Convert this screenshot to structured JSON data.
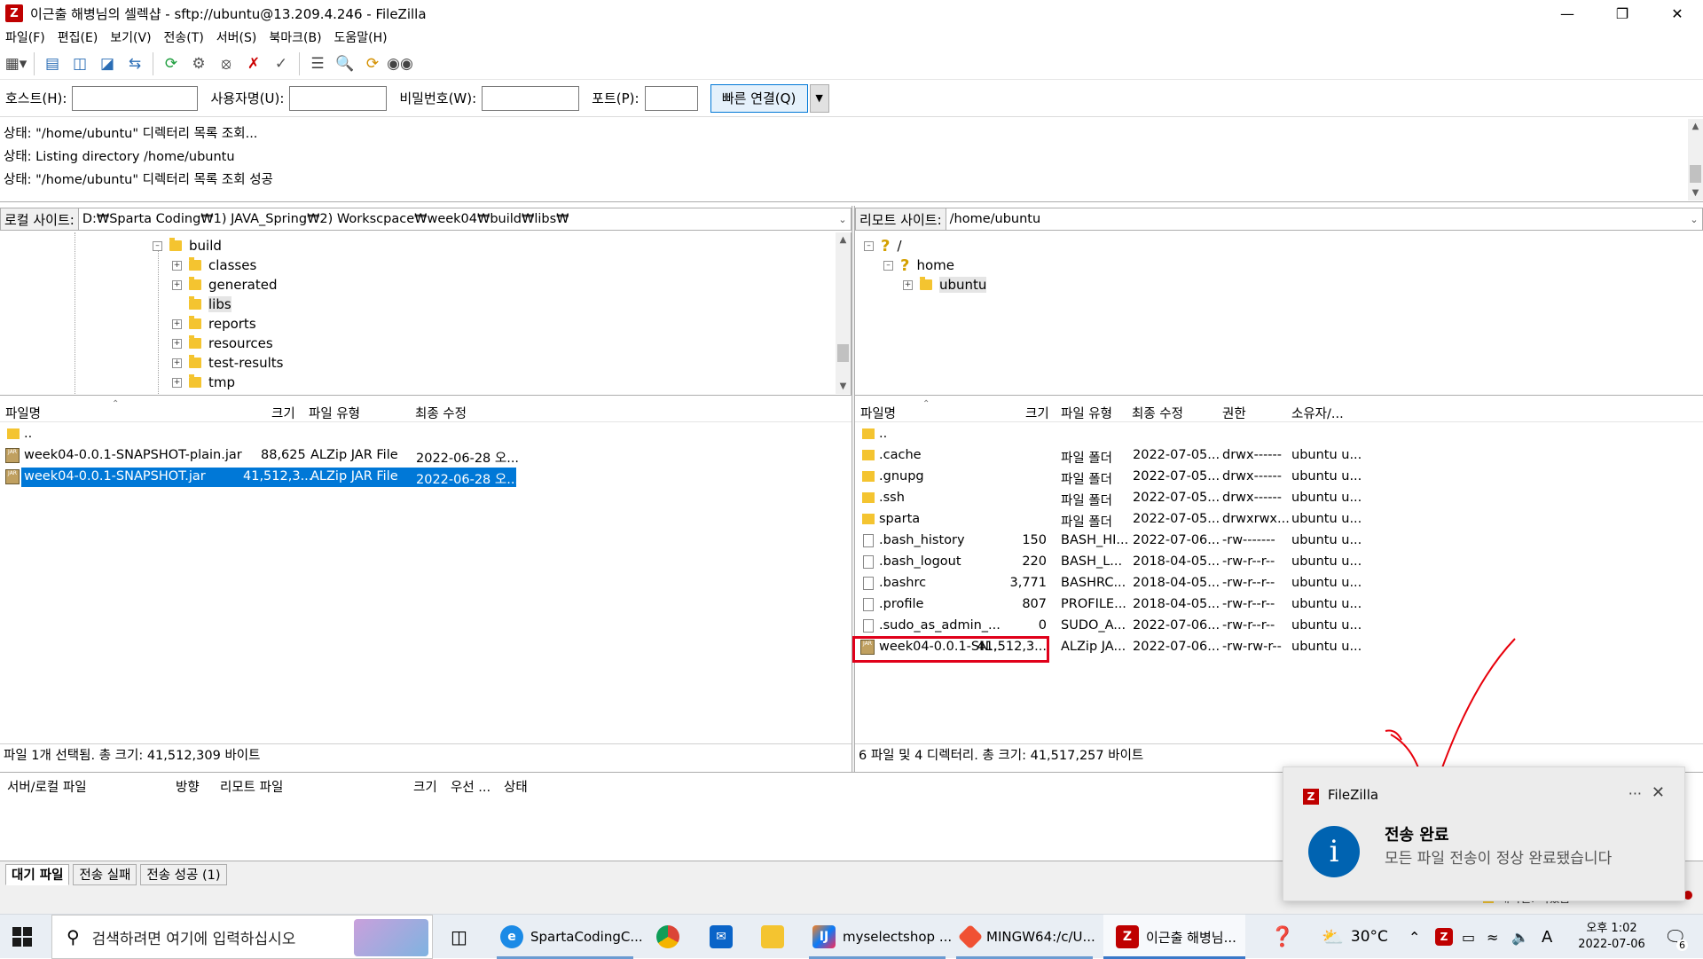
{
  "window": {
    "title": "이근출 해병님의 셀렉샵 - sftp://ubuntu@13.209.4.246 - FileZilla",
    "app_icon": "filezilla-icon"
  },
  "menu": [
    "파일(F)",
    "편집(E)",
    "보기(V)",
    "전송(T)",
    "서버(S)",
    "북마크(B)",
    "도움말(H)"
  ],
  "quickconnect": {
    "host_label": "호스트(H):",
    "host_value": "",
    "user_label": "사용자명(U):",
    "user_value": "",
    "pass_label": "비밀번호(W):",
    "pass_value": "",
    "port_label": "포트(P):",
    "port_value": "",
    "connect_button": "빠른 연결(Q)"
  },
  "log": [
    "상태: \"/home/ubuntu\" 디렉터리 목록 조회...",
    "상태: Listing directory /home/ubuntu",
    "상태: \"/home/ubuntu\" 디렉터리 목록 조회 성공"
  ],
  "local": {
    "site_label": "로컬 사이트:",
    "path": "D:₩Sparta Coding₩1) JAVA_Spring₩2) Workscpace₩week04₩build₩libs₩",
    "tree": [
      {
        "name": "build",
        "expander": "minus",
        "level": 0
      },
      {
        "name": "classes",
        "expander": "plus",
        "level": 1
      },
      {
        "name": "generated",
        "expander": "plus",
        "level": 1
      },
      {
        "name": "libs",
        "expander": "none",
        "level": 1
      },
      {
        "name": "reports",
        "expander": "plus",
        "level": 1
      },
      {
        "name": "resources",
        "expander": "plus",
        "level": 1
      },
      {
        "name": "test-results",
        "expander": "plus",
        "level": 1
      },
      {
        "name": "tmp",
        "expander": "plus",
        "level": 1
      }
    ],
    "columns": [
      "파일명",
      "크기",
      "파일 유형",
      "최종 수정"
    ],
    "files": [
      {
        "name": "..",
        "size": "",
        "type": "",
        "modified": "",
        "icon": "folder-icon",
        "selected": false
      },
      {
        "name": "week04-0.0.1-SNAPSHOT-plain.jar",
        "size": "88,625",
        "type": "ALZip JAR File",
        "modified": "2022-06-28 오...",
        "icon": "jar-icon",
        "selected": false
      },
      {
        "name": "week04-0.0.1-SNAPSHOT.jar",
        "size": "41,512,3...",
        "type": "ALZip JAR File",
        "modified": "2022-06-28 오...",
        "icon": "jar-icon",
        "selected": true
      }
    ],
    "status": "파일 1개 선택됨. 총 크기: 41,512,309 바이트"
  },
  "remote": {
    "site_label": "리모트 사이트:",
    "path": "/home/ubuntu",
    "tree": [
      {
        "name": "/",
        "icon": "question-icon",
        "expander": "minus",
        "level": 0
      },
      {
        "name": "home",
        "icon": "question-icon",
        "expander": "minus",
        "level": 1
      },
      {
        "name": "ubuntu",
        "icon": "folder-icon",
        "expander": "plus",
        "level": 2
      }
    ],
    "columns": [
      "파일명",
      "크기",
      "파일 유형",
      "최종 수정",
      "권한",
      "소유자/..."
    ],
    "files": [
      {
        "name": "..",
        "size": "",
        "type": "",
        "modified": "",
        "perm": "",
        "owner": "",
        "icon": "folder-icon"
      },
      {
        "name": ".cache",
        "size": "",
        "type": "파일 폴더",
        "modified": "2022-07-05...",
        "perm": "drwx------",
        "owner": "ubuntu u...",
        "icon": "folder-icon"
      },
      {
        "name": ".gnupg",
        "size": "",
        "type": "파일 폴더",
        "modified": "2022-07-05...",
        "perm": "drwx------",
        "owner": "ubuntu u...",
        "icon": "folder-icon"
      },
      {
        "name": ".ssh",
        "size": "",
        "type": "파일 폴더",
        "modified": "2022-07-05...",
        "perm": "drwx------",
        "owner": "ubuntu u...",
        "icon": "folder-icon"
      },
      {
        "name": "sparta",
        "size": "",
        "type": "파일 폴더",
        "modified": "2022-07-05...",
        "perm": "drwxrwx...",
        "owner": "ubuntu u...",
        "icon": "folder-icon"
      },
      {
        "name": ".bash_history",
        "size": "150",
        "type": "BASH_HI...",
        "modified": "2022-07-06...",
        "perm": "-rw-------",
        "owner": "ubuntu u...",
        "icon": "file-icon"
      },
      {
        "name": ".bash_logout",
        "size": "220",
        "type": "BASH_L...",
        "modified": "2018-04-05...",
        "perm": "-rw-r--r--",
        "owner": "ubuntu u...",
        "icon": "file-icon"
      },
      {
        "name": ".bashrc",
        "size": "3,771",
        "type": "BASHRC...",
        "modified": "2018-04-05...",
        "perm": "-rw-r--r--",
        "owner": "ubuntu u...",
        "icon": "file-icon"
      },
      {
        "name": ".profile",
        "size": "807",
        "type": "PROFILE...",
        "modified": "2018-04-05...",
        "perm": "-rw-r--r--",
        "owner": "ubuntu u...",
        "icon": "file-icon"
      },
      {
        "name": ".sudo_as_admin_...",
        "size": "0",
        "type": "SUDO_A...",
        "modified": "2022-07-06...",
        "perm": "-rw-r--r--",
        "owner": "ubuntu u...",
        "icon": "file-icon"
      },
      {
        "name": "week04-0.0.1-SN...",
        "size": "41,512,3...",
        "type": "ALZip JA...",
        "modified": "2022-07-06...",
        "perm": "-rw-rw-r--",
        "owner": "ubuntu u...",
        "icon": "jar-icon",
        "highlighted": true
      }
    ],
    "status": "6 파일 및 4 디렉터리. 총 크기: 41,517,257 바이트"
  },
  "queue": {
    "columns": [
      "서버/로컬 파일",
      "방향",
      "리모트 파일",
      "크기",
      "우선 ...",
      "상태"
    ],
    "tabs": [
      "대기 파일",
      "전송 실패",
      "전송 성공 (1)"
    ],
    "status_partial": "대기열: 비었음"
  },
  "toast": {
    "app": "FileZilla",
    "title": "전송 완료",
    "message": "모든 파일 전송이 정상 완료됐습니다",
    "more": "···",
    "close": "✕"
  },
  "taskbar": {
    "search_placeholder": "검색하려면 여기에 입력하십시오",
    "apps": [
      {
        "label": "SpartaCodingC...",
        "icon": "edge-icon"
      },
      {
        "label": "",
        "icon": "chrome-icon"
      },
      {
        "label": "",
        "icon": "mail-icon"
      },
      {
        "label": "",
        "icon": "file-explorer-icon"
      },
      {
        "label": "myselectshop ...",
        "icon": "intellij-icon"
      },
      {
        "label": "MINGW64:/c/U...",
        "icon": "git-bash-icon"
      },
      {
        "label": "이근출 해병님...",
        "icon": "filezilla-icon"
      }
    ],
    "weather": "30°C",
    "ime": "A",
    "time": "오후 1:02",
    "date": "2022-07-06",
    "notifications": "6"
  },
  "colors": {
    "selection": "#0078d7",
    "highlight_box": "#e0001a",
    "annotation_check": "#e8000b",
    "toast_info": "#0063b1"
  }
}
